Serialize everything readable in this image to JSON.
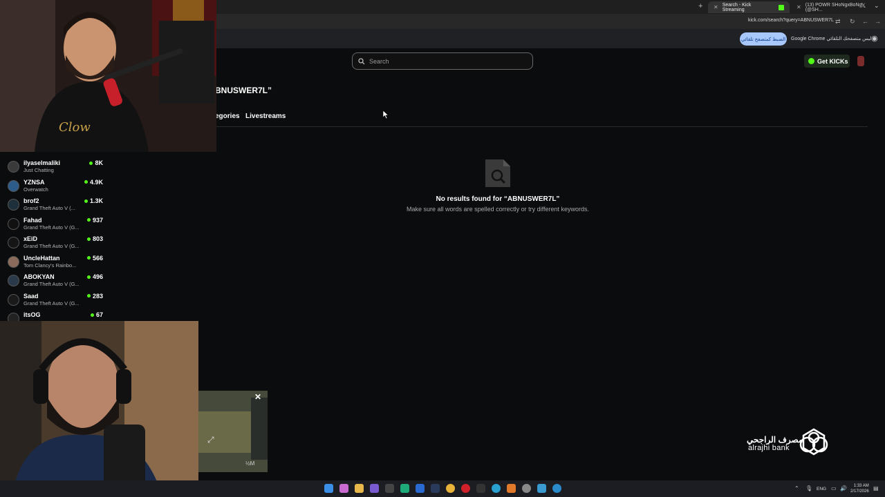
{
  "browser": {
    "tabs": [
      {
        "title": "Search - Kick Streaming",
        "active": true
      },
      {
        "title": "(13) POWR SHoNgxBoNg (@SH..."
      }
    ],
    "url": "kick.com/search?query=ABNUSWER7L",
    "infobar": {
      "message": "ليس متصفحك التلقائي Google Chrome",
      "button_label": "الضبط كمتصفح تلقائي"
    }
  },
  "kick": {
    "search_placeholder": "Search",
    "get_kicks_label": "Get KICKs",
    "results_heading": "BNUSWER7L”",
    "tabs": [
      "egories",
      "Livestreams"
    ],
    "empty_title": "No results found for “ABNUSWER7L”",
    "empty_subtitle": "Make sure all words are spelled correctly or try different keywords."
  },
  "channels": [
    {
      "name": "ilyaselmaliki",
      "game": "Just Chatting",
      "viewers": "8K"
    },
    {
      "name": "YZNSA",
      "game": "Overwatch",
      "viewers": "4.9K"
    },
    {
      "name": "brof2",
      "game": "Grand Theft Auto V (...",
      "viewers": "1.3K"
    },
    {
      "name": "Fahad",
      "game": "Grand Theft Auto V (G...",
      "viewers": "937"
    },
    {
      "name": "xEiD",
      "game": "Grand Theft Auto V (G...",
      "viewers": "803"
    },
    {
      "name": "UncleHattan",
      "game": "Tom Clancy's Rainbo...",
      "viewers": "566"
    },
    {
      "name": "ABOKYAN",
      "game": "Grand Theft Auto V (G...",
      "viewers": "496"
    },
    {
      "name": "Saad",
      "game": "Grand Theft Auto V (G...",
      "viewers": "283"
    },
    {
      "name": "itsOG",
      "game": "",
      "viewers": "67"
    }
  ],
  "miniplayer": {
    "close_label": "✕",
    "viewer_count": "½M"
  },
  "overlay": {
    "bank_arabic": "مصرف الراجحي",
    "bank_english": "alrajhi bank",
    "cam1_shirt_text": "Clow"
  },
  "taskbar": {
    "language": "ENG",
    "time": "1:33 AM",
    "date": "2/17/2026"
  },
  "colors": {
    "kick_green": "#53fc18",
    "page_bg": "#0b0c0d",
    "chrome_infobar_button": "#a8c7fa"
  }
}
